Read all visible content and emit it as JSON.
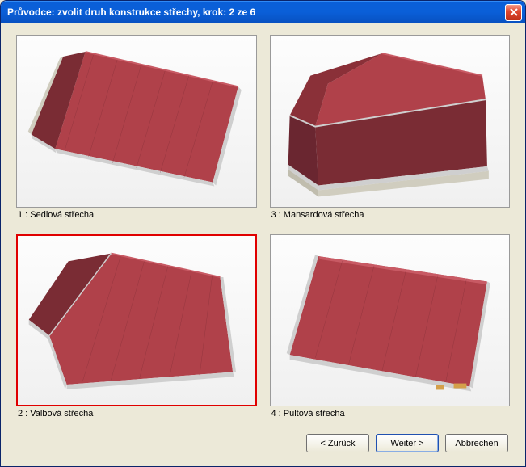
{
  "window": {
    "title": "Průvodce: zvolit druh konstrukce střechy, krok: 2 ze 6"
  },
  "options": [
    {
      "label": "1 : Sedlová střecha",
      "selected": false
    },
    {
      "label": "3 : Mansardová střecha",
      "selected": false
    },
    {
      "label": "2 : Valbová střecha",
      "selected": true
    },
    {
      "label": "4 : Pultová střecha",
      "selected": false
    }
  ],
  "buttons": {
    "back": "< Zurück",
    "next": "Weiter >",
    "cancel": "Abbrechen"
  },
  "colors": {
    "roof_fill": "#b0414a",
    "roof_dark": "#7a2c34",
    "roof_light": "#c85a64",
    "edge": "#cfcfcf",
    "wall": "#d0cdbf",
    "wood": "#d4a04a"
  }
}
